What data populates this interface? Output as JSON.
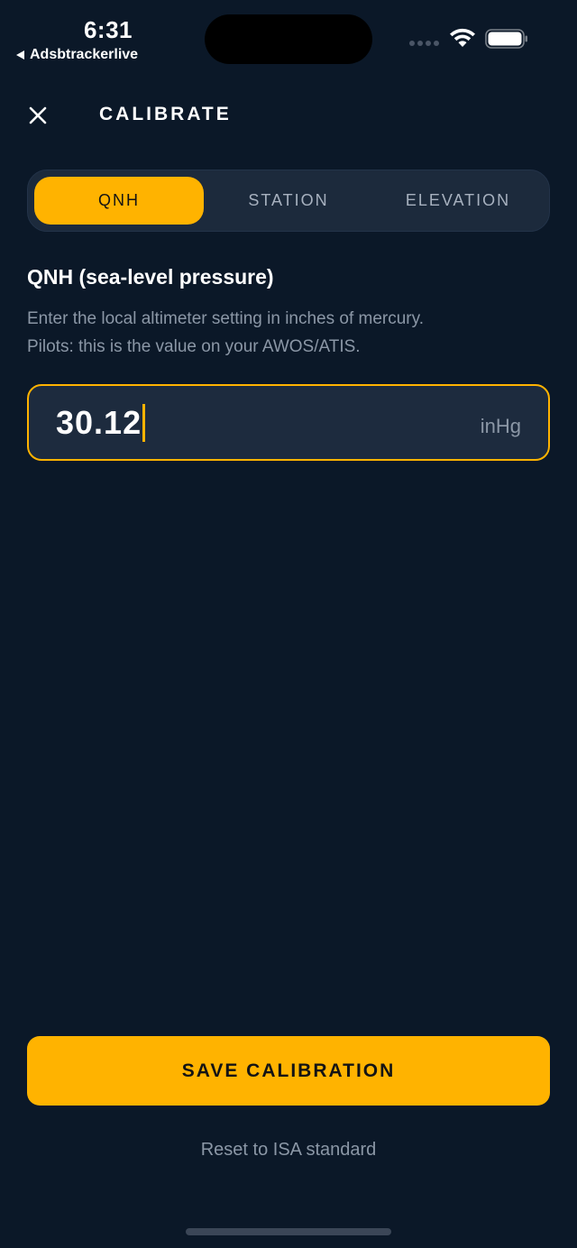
{
  "status_bar": {
    "time": "6:31",
    "back_app": "Adsbtrackerlive"
  },
  "header": {
    "title": "CALIBRATE",
    "close_icon": "close-icon"
  },
  "tabs": [
    {
      "label": "QNH",
      "active": true
    },
    {
      "label": "STATION",
      "active": false
    },
    {
      "label": "ELEVATION",
      "active": false
    }
  ],
  "field": {
    "title": "QNH (sea-level pressure)",
    "description_line1": "Enter the local altimeter setting in inches of mercury.",
    "description_line2": "Pilots: this is the value on your AWOS/ATIS.",
    "value": "30.12",
    "unit": "inHg"
  },
  "actions": {
    "save_label": "SAVE CALIBRATION",
    "reset_label": "Reset to ISA standard"
  },
  "colors": {
    "background": "#0b1828",
    "accent": "#ffb300",
    "surface": "#1c2a3c",
    "muted_text": "#8b97a6"
  }
}
